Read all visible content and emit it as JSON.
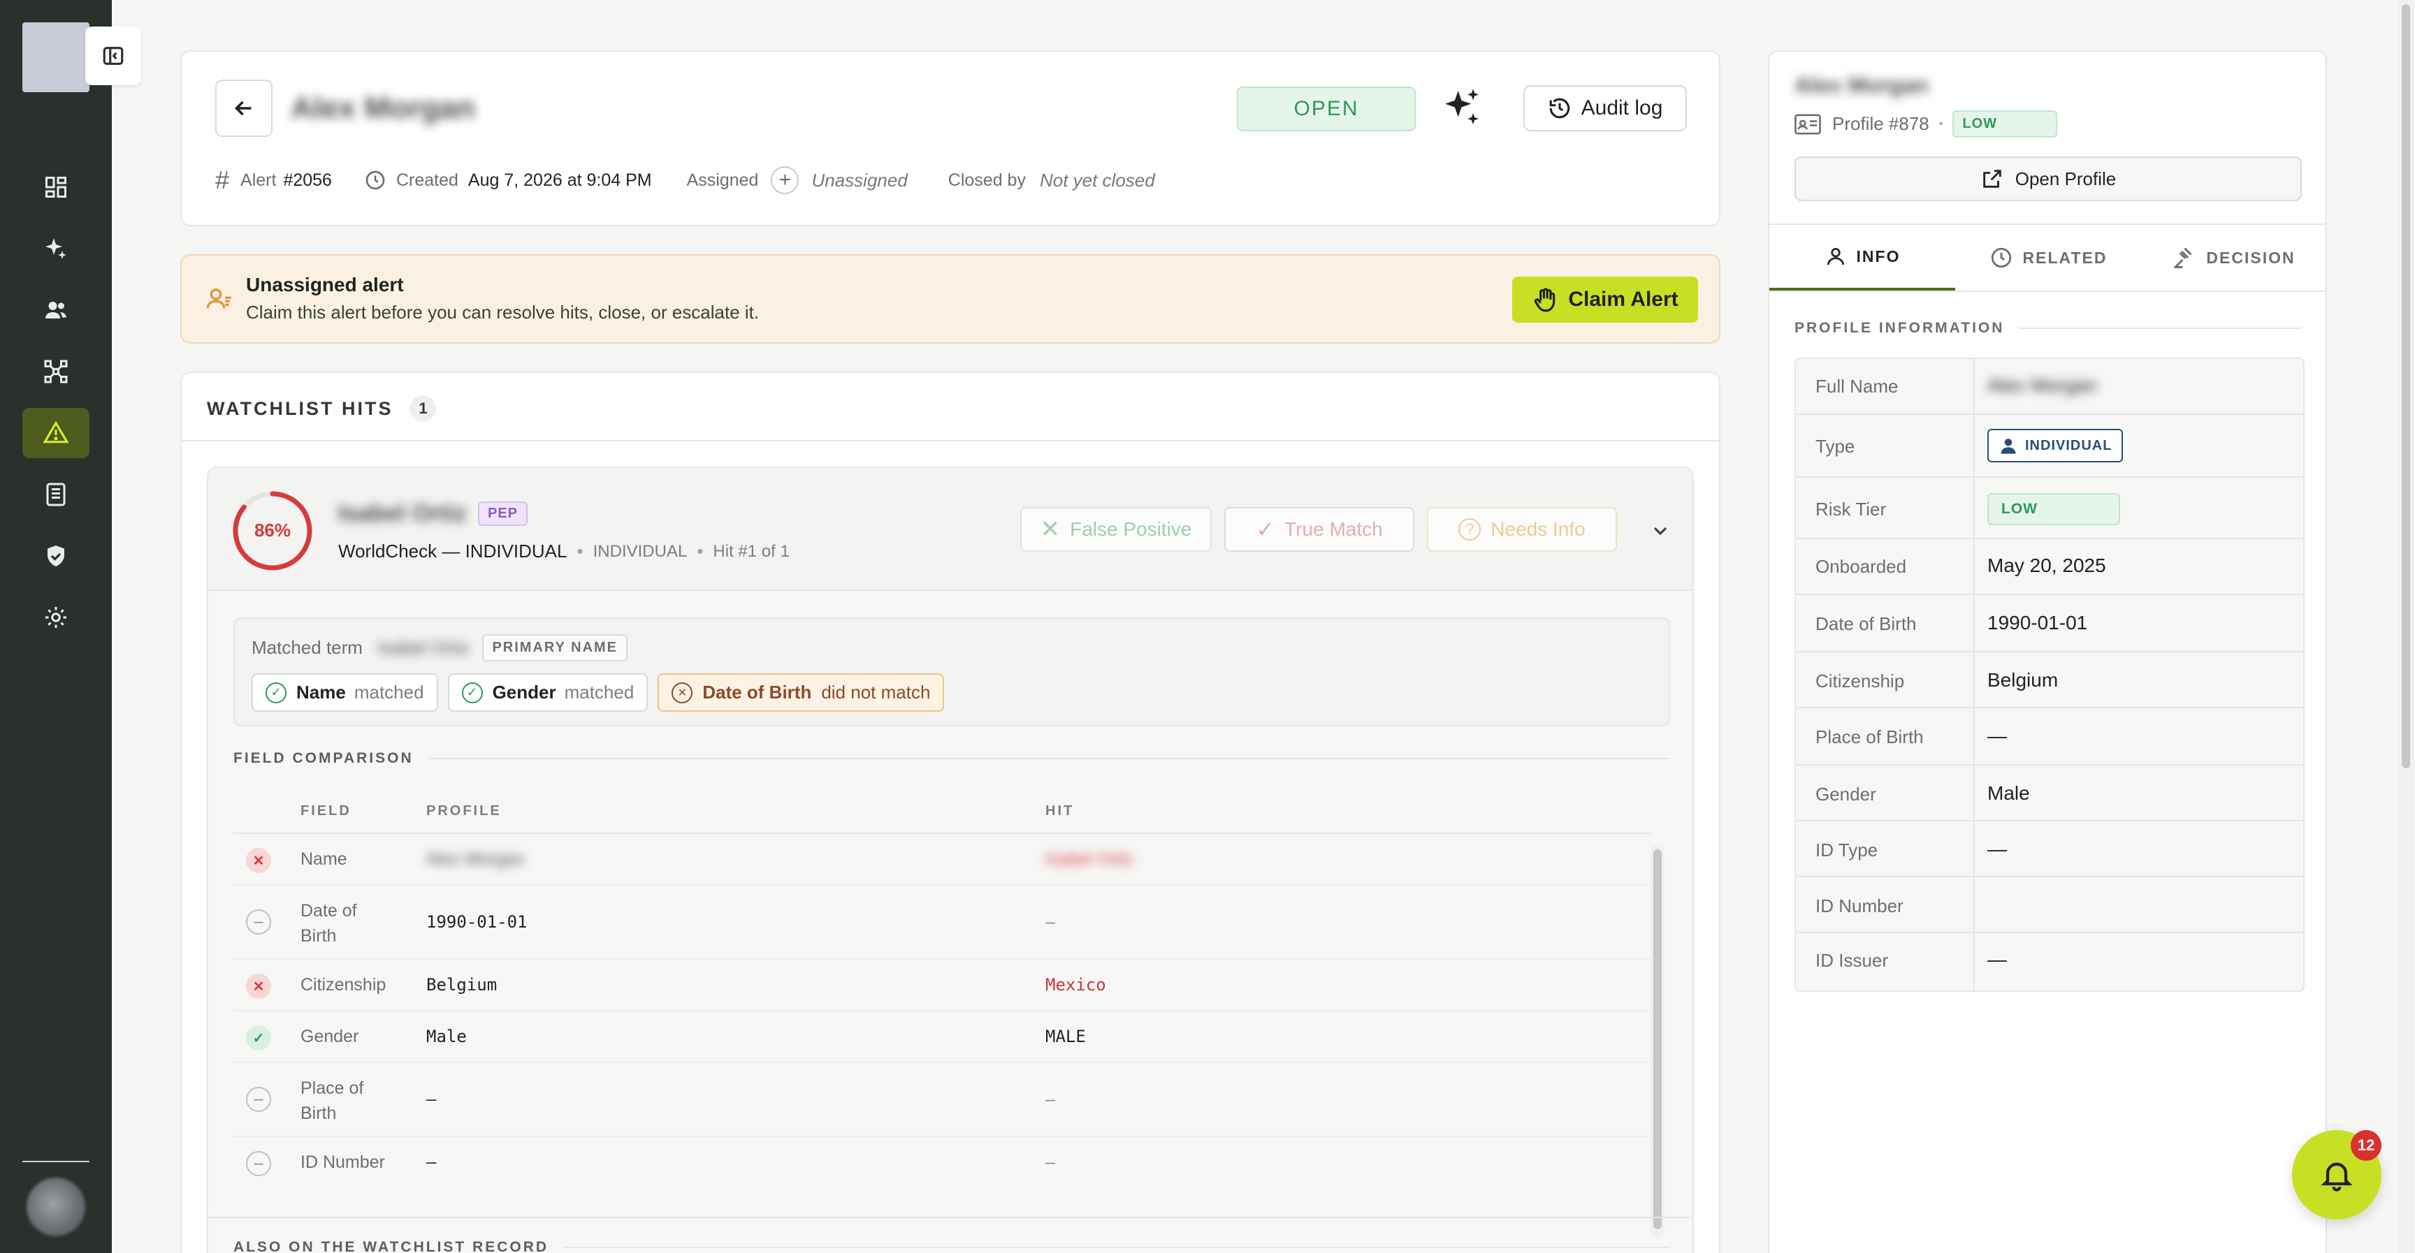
{
  "colors": {
    "sidebar_bg": "#2b302d",
    "accent_lime": "#c8e024",
    "open_green": "#2e9a57",
    "danger_red": "#d63b3b",
    "warning_orange": "#d99a3a",
    "pep_purple": "#8b5cc8",
    "banner_bg": "#fbf1e2"
  },
  "sidebar": {
    "items": [
      {
        "icon": "dashboard-icon"
      },
      {
        "icon": "sparkles-icon"
      },
      {
        "icon": "users-icon"
      },
      {
        "icon": "network-icon"
      },
      {
        "icon": "alert-triangle-icon",
        "active": true
      },
      {
        "icon": "report-icon"
      },
      {
        "icon": "shield-check-icon"
      },
      {
        "icon": "settings-icon"
      }
    ]
  },
  "header": {
    "title": "Alex Morgan",
    "status": "OPEN",
    "audit_log_label": "Audit log",
    "alert_label": "Alert",
    "alert_id": "#2056",
    "created_label": "Created",
    "created_value": "Aug 7, 2026 at 9:04 PM",
    "assigned_label": "Assigned",
    "assigned_value": "Unassigned",
    "closed_label": "Closed by",
    "closed_value": "Not yet closed"
  },
  "banner": {
    "title": "Unassigned alert",
    "subtitle": "Claim this alert before you can resolve hits, close, or escalate it.",
    "claim_label": "Claim Alert"
  },
  "watchlist": {
    "title": "WATCHLIST HITS",
    "count": "1",
    "hit": {
      "score": "86%",
      "score_fraction": 0.86,
      "name": "Isabel Ortiz",
      "tag": "PEP",
      "source": "WorldCheck — INDIVIDUAL",
      "type": "INDIVIDUAL",
      "position": "Hit #1 of 1",
      "false_positive": "False Positive",
      "true_match": "True Match",
      "needs_info": "Needs Info",
      "matched_term_label": "Matched term",
      "matched_term_value": "Isabel Ortiz",
      "primary_name": "PRIMARY NAME",
      "chips": [
        {
          "field": "Name",
          "status": "matched",
          "ok": true
        },
        {
          "field": "Gender",
          "status": "matched",
          "ok": true
        },
        {
          "field": "Date of Birth",
          "status": "did not match",
          "ok": false
        }
      ],
      "comparison_title": "FIELD COMPARISON",
      "columns": [
        "FIELD",
        "PROFILE",
        "HIT"
      ],
      "rows": [
        {
          "state": "mismatch",
          "field": "Name",
          "profile": "Alex Morgan",
          "hit": "Isabel Ortiz",
          "blurred": true
        },
        {
          "state": "neutral",
          "field": "Date of Birth",
          "profile": "1990-01-01",
          "hit": "–"
        },
        {
          "state": "mismatch",
          "field": "Citizenship",
          "profile": "Belgium",
          "hit": "Mexico"
        },
        {
          "state": "match",
          "field": "Gender",
          "profile": "Male",
          "hit": "MALE"
        },
        {
          "state": "neutral",
          "field": "Place of Birth",
          "profile": "—",
          "hit": "–"
        },
        {
          "state": "neutral",
          "field": "ID Number",
          "profile": "—",
          "hit": "–"
        }
      ],
      "also_on_title": "ALSO ON THE WATCHLIST RECORD"
    }
  },
  "profile": {
    "name": "Alex Morgan",
    "profile_id": "Profile #878",
    "risk": "LOW",
    "open_profile_label": "Open Profile",
    "tabs": [
      {
        "label": "INFO",
        "icon": "person-icon",
        "active": true
      },
      {
        "label": "RELATED",
        "icon": "clock-icon"
      },
      {
        "label": "DECISION",
        "icon": "gavel-icon"
      }
    ],
    "section_title": "PROFILE INFORMATION",
    "fields": [
      {
        "label": "Full Name",
        "value": "Alex Morgan",
        "blurred": true
      },
      {
        "label": "Type",
        "value": "INDIVIDUAL",
        "badge": "individual"
      },
      {
        "label": "Risk Tier",
        "value": "LOW",
        "badge": "low"
      },
      {
        "label": "Onboarded",
        "value": "May 20, 2025"
      },
      {
        "label": "Date of Birth",
        "value": "1990-01-01"
      },
      {
        "label": "Citizenship",
        "value": "Belgium"
      },
      {
        "label": "Place of Birth",
        "value": "—"
      },
      {
        "label": "Gender",
        "value": "Male"
      },
      {
        "label": "ID Type",
        "value": "—"
      },
      {
        "label": "ID Number",
        "value": ""
      },
      {
        "label": "ID Issuer",
        "value": "—"
      }
    ]
  },
  "notifications": {
    "count": "12"
  }
}
